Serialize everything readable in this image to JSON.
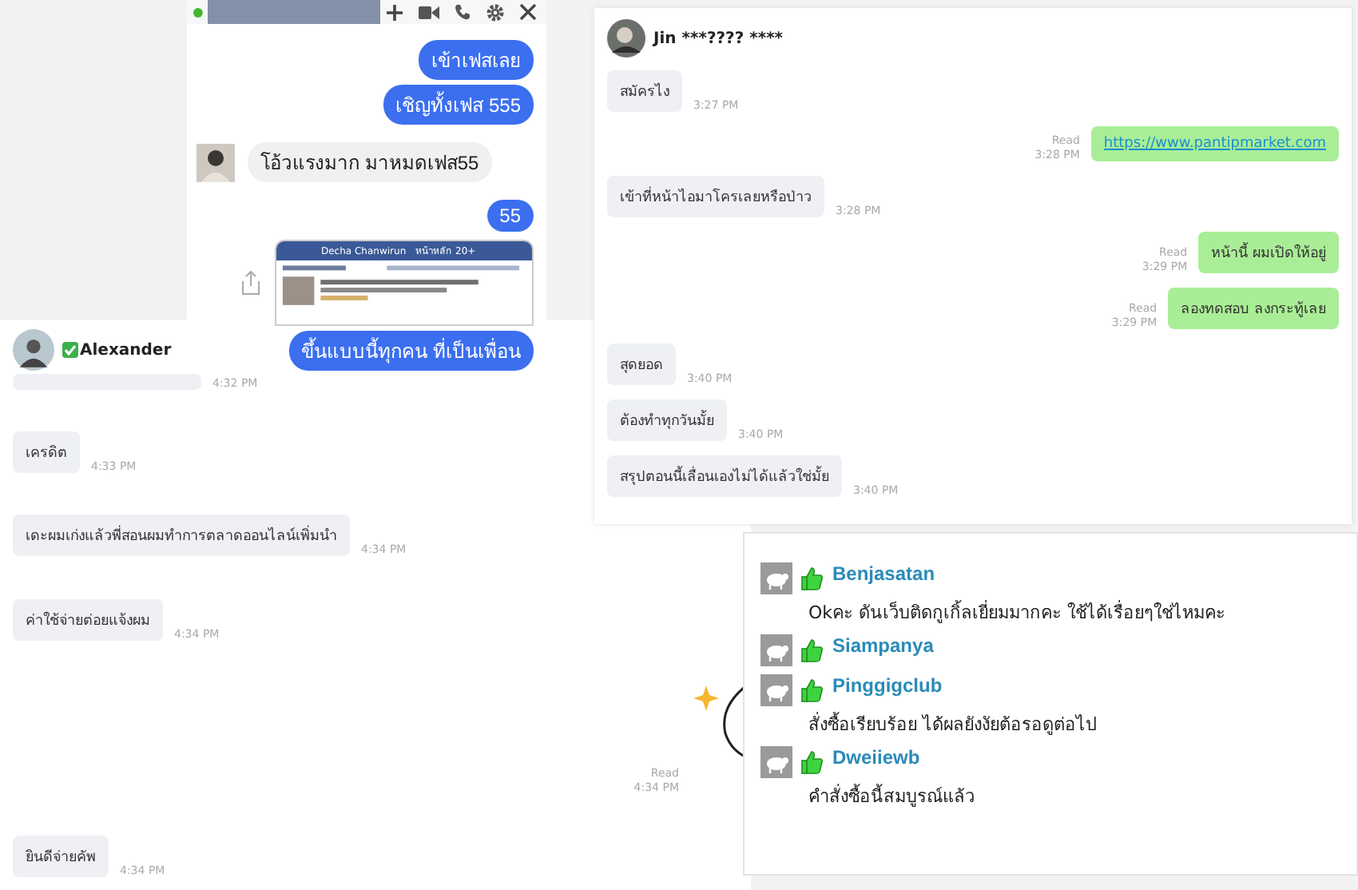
{
  "messenger": {
    "online": true,
    "messages": [
      {
        "kind": "sent",
        "text": "เข้าเฟสเลย"
      },
      {
        "kind": "sent",
        "text": "เชิญทั้งเฟส 555"
      },
      {
        "kind": "received",
        "text": "โอ้วแรงมาก มาหมดเฟส55"
      },
      {
        "kind": "sent",
        "text": "55"
      },
      {
        "kind": "screenshot",
        "name": "Decha Chanwirun",
        "nav": "หน้าหลัก 20+"
      },
      {
        "kind": "sent",
        "text": "ขึ้นแบบนี้ทุกคน ที่เป็นเพื่อน"
      }
    ]
  },
  "line_chat": {
    "contact": "Jin ***???? ****",
    "messages": [
      {
        "kind": "received",
        "text": "สมัครไง",
        "time": "3:27 PM"
      },
      {
        "kind": "sent",
        "text": "https://www.pantipmarket.com",
        "link": true,
        "read": "Read",
        "time": "3:28 PM"
      },
      {
        "kind": "received",
        "text": "เข้าที่หน้าไอมาโครเลยหรือป่าว",
        "time": "3:28 PM"
      },
      {
        "kind": "sent",
        "text": "หน้านี้ ผมเปิดให้อยู่",
        "link": false,
        "read": "Read",
        "time": "3:29 PM"
      },
      {
        "kind": "sent",
        "text": "ลองทดสอบ ลงกระทู้เลย",
        "link": false,
        "read": "Read",
        "time": "3:29 PM"
      },
      {
        "kind": "received",
        "text": "สุดยอด",
        "time": "3:40 PM"
      },
      {
        "kind": "received",
        "text": "ต้องทำทุกวันมั้ย",
        "time": "3:40 PM"
      },
      {
        "kind": "received",
        "text": "สรุปตอนนี้เลื่อนเองไม่ได้แล้วใช่มั้ย",
        "time": "3:40 PM"
      }
    ]
  },
  "alexander_chat": {
    "contact": "Alexander",
    "verified": true,
    "messages": [
      {
        "kind": "masked",
        "time": "4:32 PM"
      },
      {
        "kind": "received",
        "text": "เครดิต",
        "time": "4:33 PM"
      },
      {
        "kind": "received",
        "text": "เดะผมเก่งแล้วพี่สอนผมทำการตลาดออนไลน์เพิ่มนำ",
        "time": "4:34 PM"
      },
      {
        "kind": "received",
        "text": "ค่าใช้จ่ายต่อยแจ้งผม",
        "time": "4:34 PM"
      },
      {
        "kind": "sticker",
        "read": "Read",
        "time": "4:34 PM"
      },
      {
        "kind": "received",
        "text": "ยินดีจ่ายคัพ",
        "time": "4:34 PM"
      }
    ]
  },
  "comments": [
    {
      "name": "Benjasatan",
      "text": "Okคะ ดันเว็บติดกูเกิ้ลเยี่ยมมากคะ ใช้ได้เรื่อยๆใช่ไหมคะ"
    },
    {
      "name": "Siampanya"
    },
    {
      "name": "Pinggigclub",
      "text": "สั่งซื้อเรียบร้อย ได้ผลยังงัยต้อรอดูต่อไป"
    },
    {
      "name": "Dweiiewb",
      "text": "คำสั่งซื้อนี้สมบูรณ์แล้ว"
    }
  ]
}
